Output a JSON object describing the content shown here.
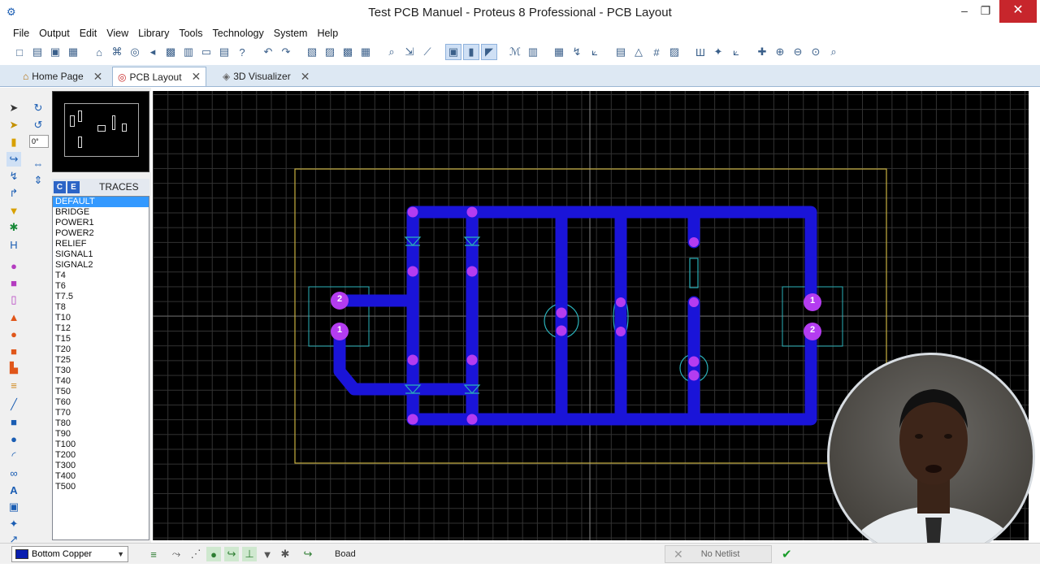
{
  "window": {
    "title": "Test PCB Manuel - Proteus 8 Professional - PCB Layout",
    "min": "–",
    "max": "❐",
    "close": "✕"
  },
  "menu": [
    "File",
    "Output",
    "Edit",
    "View",
    "Library",
    "Tools",
    "Technology",
    "System",
    "Help"
  ],
  "toolbar_icons": [
    "new-icon",
    "open-icon",
    "save-icon",
    "close-project-icon",
    "sep",
    "home-icon",
    "schematic-icon",
    "pcb-icon",
    "back-icon",
    "gerber-icon",
    "bom-icon",
    "notes-icon",
    "design-explorer-icon",
    "help-icon",
    "sep",
    "undo-icon",
    "redo-icon",
    "sep",
    "cut-icon",
    "copy-icon",
    "paste-icon",
    "delete-icon",
    "sep",
    "zoom-area-icon",
    "auto-router-icon",
    "tool-icon",
    "sep",
    "select-mode-icon",
    "pick-icon",
    "route-mode-icon",
    "sep",
    "search-icon",
    "library-icon",
    "sep",
    "design-rules-icon",
    "autoplace-icon",
    "drc-icon",
    "sep",
    "netlist-icon",
    "3d-icon",
    "grid-icon",
    "layers-icon",
    "sep",
    "origin-icon",
    "pin-icon",
    "measure-icon",
    "sep",
    "crosshair-icon",
    "zoom-in-icon",
    "zoom-out-icon",
    "zoom-all-icon",
    "zoom-window-icon"
  ],
  "tabs": [
    {
      "label": "Home Page",
      "icon": "⌂"
    },
    {
      "label": "PCB Layout",
      "icon": "◎"
    },
    {
      "label": "3D Visualizer",
      "icon": "◈"
    }
  ],
  "rotation_value": "0°",
  "panel": {
    "btn_c": "C",
    "btn_e": "E",
    "title": "TRACES",
    "selected": "DEFAULT",
    "items": [
      "DEFAULT",
      "BRIDGE",
      "POWER1",
      "POWER2",
      "RELIEF",
      "SIGNAL1",
      "SIGNAL2",
      "T4",
      "T6",
      "T7.5",
      "T8",
      "T10",
      "T12",
      "T15",
      "T20",
      "T25",
      "T30",
      "T40",
      "T50",
      "T60",
      "T70",
      "T80",
      "T90",
      "T100",
      "T200",
      "T300",
      "T400",
      "T500"
    ]
  },
  "board": {
    "pad_labels": [
      "2",
      "1",
      "1",
      "2"
    ]
  },
  "status": {
    "layer": "Bottom Copper",
    "layer_color": "#0a1fb0",
    "field": "Boad",
    "netlist": "No Netlist",
    "x_icon": "✕",
    "check_icon": "✔"
  },
  "colors": {
    "trace": "#1a14d8",
    "pad": "#b43cf0",
    "outline": "#c8b040",
    "footprint": "#2ab0b8"
  }
}
